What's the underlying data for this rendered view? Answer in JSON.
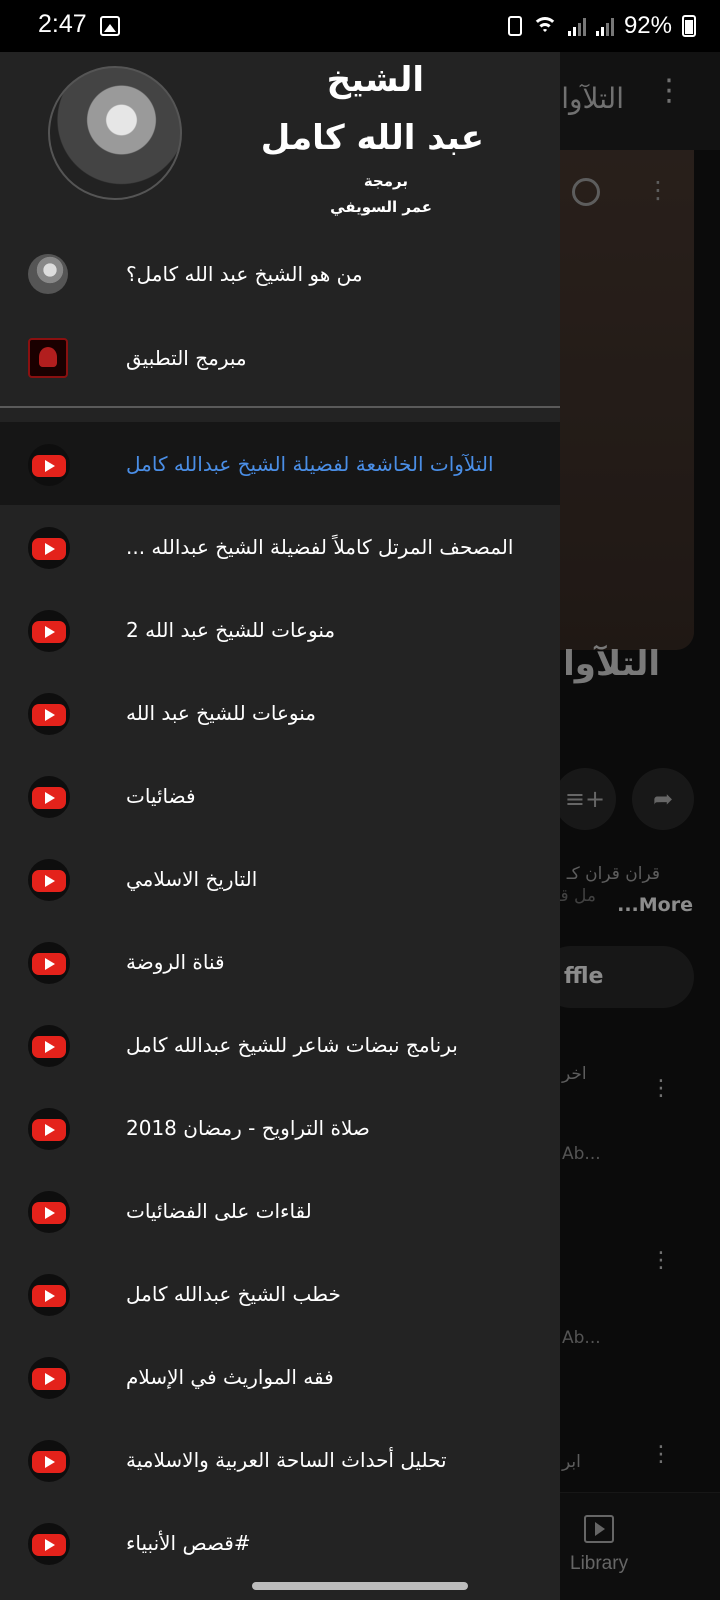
{
  "status_bar": {
    "time": "2:47",
    "battery_percent": "92%"
  },
  "background_app": {
    "toolbar_title": "التلآوات",
    "page_title": "التلآوا",
    "description": "قران قران كـ",
    "description_line2": "مل قـ",
    "more_label": "...More",
    "shuffle_label": "ffle",
    "rows": [
      {
        "title": "اخر",
        "subtitle": "Ab..."
      },
      {
        "title": "",
        "subtitle": "Ab..."
      },
      {
        "title": "ابر",
        "subtitle": ""
      }
    ],
    "nav": {
      "library_label": "Library"
    }
  },
  "drawer": {
    "header": {
      "title_line1": "الشيخ",
      "title_line2": "عبد الله كامل",
      "credit_line1": "برمجة",
      "credit_line2": "عمر السويفي"
    },
    "info_items": [
      {
        "label": "من هو الشيخ عبد الله كامل؟",
        "icon": "sheikh-avatar-icon"
      },
      {
        "label": "مبرمج التطبيق",
        "icon": "developer-logo-icon"
      }
    ],
    "playlists": [
      {
        "label": "التلآوات الخاشعة لفضيلة الشيخ عبدالله كامل",
        "active": true
      },
      {
        "label": "المصحف المرتل كاملاً لفضيلة الشيخ عبدالله ...",
        "active": false
      },
      {
        "label": "منوعات للشيخ عبد الله 2",
        "active": false
      },
      {
        "label": "منوعات للشيخ عبد الله",
        "active": false
      },
      {
        "label": "فضائيات",
        "active": false
      },
      {
        "label": "التاريخ الاسلامي",
        "active": false
      },
      {
        "label": "قناة الروضة",
        "active": false
      },
      {
        "label": "برنامج نبضات شاعر للشيخ عبدالله كامل",
        "active": false
      },
      {
        "label": "صلاة التراويح - رمضان 2018",
        "active": false
      },
      {
        "label": "لقاءات على الفضائيات",
        "active": false
      },
      {
        "label": "خطب الشيخ عبدالله كامل",
        "active": false
      },
      {
        "label": "فقه المواريث في الإسلام",
        "active": false
      },
      {
        "label": "تحليل أحداث الساحة العربية والاسلامية",
        "active": false
      },
      {
        "label": "#قصص الأنبياء",
        "active": false
      }
    ]
  },
  "colors": {
    "drawer_bg": "#232323",
    "active_text": "#4a8ee6",
    "youtube_red": "#e4221b"
  }
}
